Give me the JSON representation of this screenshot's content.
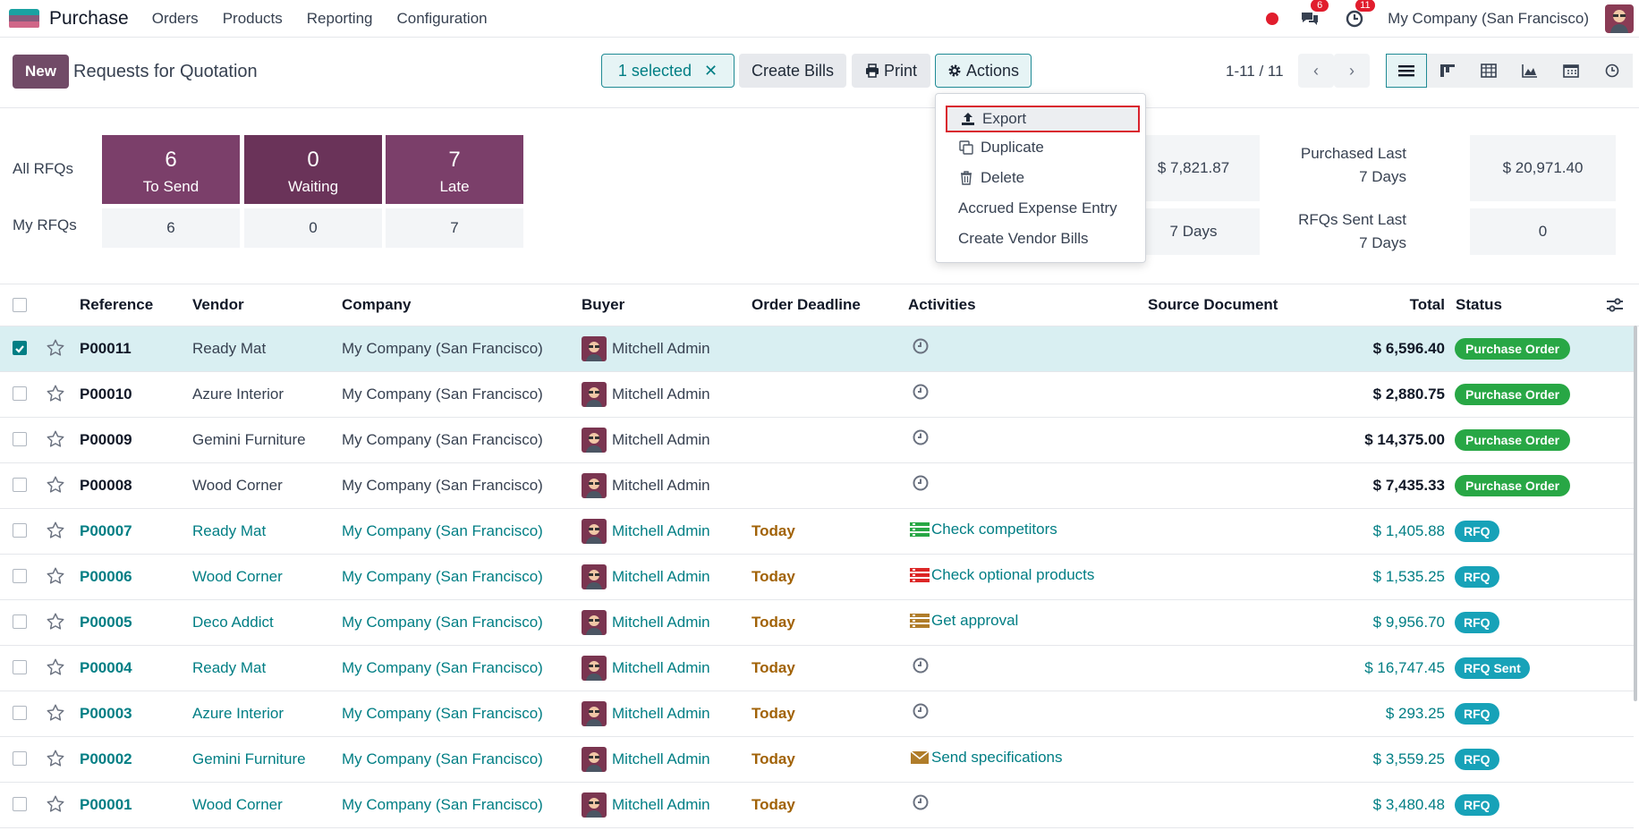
{
  "nav": {
    "app_name": "Purchase",
    "menu": [
      "Orders",
      "Products",
      "Reporting",
      "Configuration"
    ],
    "chat_badge": "6",
    "activity_badge": "11",
    "company": "My Company (San Francisco)"
  },
  "control": {
    "new_label": "New",
    "title": "Requests for Quotation",
    "selected_label": "1 selected",
    "create_bills_label": "Create Bills",
    "print_label": "Print",
    "actions_label": "Actions",
    "pager": "1-11 / 11"
  },
  "dashboard": {
    "all_rfqs_label": "All RFQs",
    "my_rfqs_label": "My RFQs",
    "tiles": [
      {
        "num": "6",
        "label": "To Send",
        "mine": "6"
      },
      {
        "num": "0",
        "label": "Waiting",
        "mine": "0"
      },
      {
        "num": "7",
        "label": "Late",
        "mine": "7"
      }
    ],
    "kpi1_value": "$ 7,821.87",
    "kpi2_value": "7 Days",
    "purchased_label": "Purchased Last 7 Days",
    "purchased_value": "$ 20,971.40",
    "rfqs_sent_label": "RFQs Sent Last 7 Days",
    "rfqs_sent_value": "0"
  },
  "actions_menu": {
    "export": "Export",
    "duplicate": "Duplicate",
    "delete": "Delete",
    "accrued": "Accrued Expense Entry",
    "create_vendor_bills": "Create Vendor Bills"
  },
  "table": {
    "headers": {
      "reference": "Reference",
      "vendor": "Vendor",
      "company": "Company",
      "buyer": "Buyer",
      "deadline": "Order Deadline",
      "activities": "Activities",
      "source": "Source Document",
      "total": "Total",
      "status": "Status"
    },
    "rows": [
      {
        "ref": "P00011",
        "vendor": "Ready Mat",
        "company": "My Company (San Francisco)",
        "buyer": "Mitchell Admin",
        "deadline": "",
        "activity": "",
        "total": "$ 6,596.40",
        "status": "Purchase Order"
      },
      {
        "ref": "P00010",
        "vendor": "Azure Interior",
        "company": "My Company (San Francisco)",
        "buyer": "Mitchell Admin",
        "deadline": "",
        "activity": "",
        "total": "$ 2,880.75",
        "status": "Purchase Order"
      },
      {
        "ref": "P00009",
        "vendor": "Gemini Furniture",
        "company": "My Company (San Francisco)",
        "buyer": "Mitchell Admin",
        "deadline": "",
        "activity": "",
        "total": "$ 14,375.00",
        "status": "Purchase Order"
      },
      {
        "ref": "P00008",
        "vendor": "Wood Corner",
        "company": "My Company (San Francisco)",
        "buyer": "Mitchell Admin",
        "deadline": "",
        "activity": "",
        "total": "$ 7,435.33",
        "status": "Purchase Order"
      },
      {
        "ref": "P00007",
        "vendor": "Ready Mat",
        "company": "My Company (San Francisco)",
        "buyer": "Mitchell Admin",
        "deadline": "Today",
        "activity": "Check competitors",
        "total": "$ 1,405.88",
        "status": "RFQ"
      },
      {
        "ref": "P00006",
        "vendor": "Wood Corner",
        "company": "My Company (San Francisco)",
        "buyer": "Mitchell Admin",
        "deadline": "Today",
        "activity": "Check optional products",
        "total": "$ 1,535.25",
        "status": "RFQ"
      },
      {
        "ref": "P00005",
        "vendor": "Deco Addict",
        "company": "My Company (San Francisco)",
        "buyer": "Mitchell Admin",
        "deadline": "Today",
        "activity": "Get approval",
        "total": "$ 9,956.70",
        "status": "RFQ"
      },
      {
        "ref": "P00004",
        "vendor": "Ready Mat",
        "company": "My Company (San Francisco)",
        "buyer": "Mitchell Admin",
        "deadline": "Today",
        "activity": "",
        "total": "$ 16,747.45",
        "status": "RFQ Sent"
      },
      {
        "ref": "P00003",
        "vendor": "Azure Interior",
        "company": "My Company (San Francisco)",
        "buyer": "Mitchell Admin",
        "deadline": "Today",
        "activity": "",
        "total": "$ 293.25",
        "status": "RFQ"
      },
      {
        "ref": "P00002",
        "vendor": "Gemini Furniture",
        "company": "My Company (San Francisco)",
        "buyer": "Mitchell Admin",
        "deadline": "Today",
        "activity": "Send specifications",
        "total": "$ 3,559.25",
        "status": "RFQ"
      },
      {
        "ref": "P00001",
        "vendor": "Wood Corner",
        "company": "My Company (San Francisco)",
        "buyer": "Mitchell Admin",
        "deadline": "Today",
        "activity": "",
        "total": "$ 3,480.48",
        "status": "RFQ"
      }
    ]
  },
  "colors": {
    "brand": "#714b67",
    "accent": "#017e84",
    "purchase_order": "#28a745",
    "rfq": "#17a2b8",
    "today": "#a16207"
  }
}
